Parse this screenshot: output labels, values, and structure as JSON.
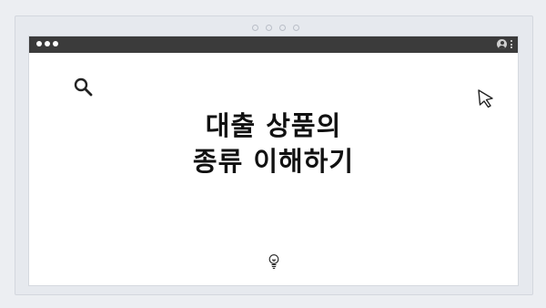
{
  "window": {
    "title_bar": {
      "traffic_dots": 3,
      "right_icons": [
        "user-icon",
        "kebab-menu-icon"
      ]
    }
  },
  "carousel": {
    "page_indicator_count": 4
  },
  "content": {
    "headline_line1": "대출 상품의",
    "headline_line2": "종류 이해하기",
    "decor_icons": [
      "search-icon",
      "cursor-arrow-icon",
      "lightbulb-icon"
    ]
  },
  "colors": {
    "background": "#eceef2",
    "titlebar": "#3b3b3b",
    "canvas": "#ffffff",
    "headline": "#111111"
  }
}
